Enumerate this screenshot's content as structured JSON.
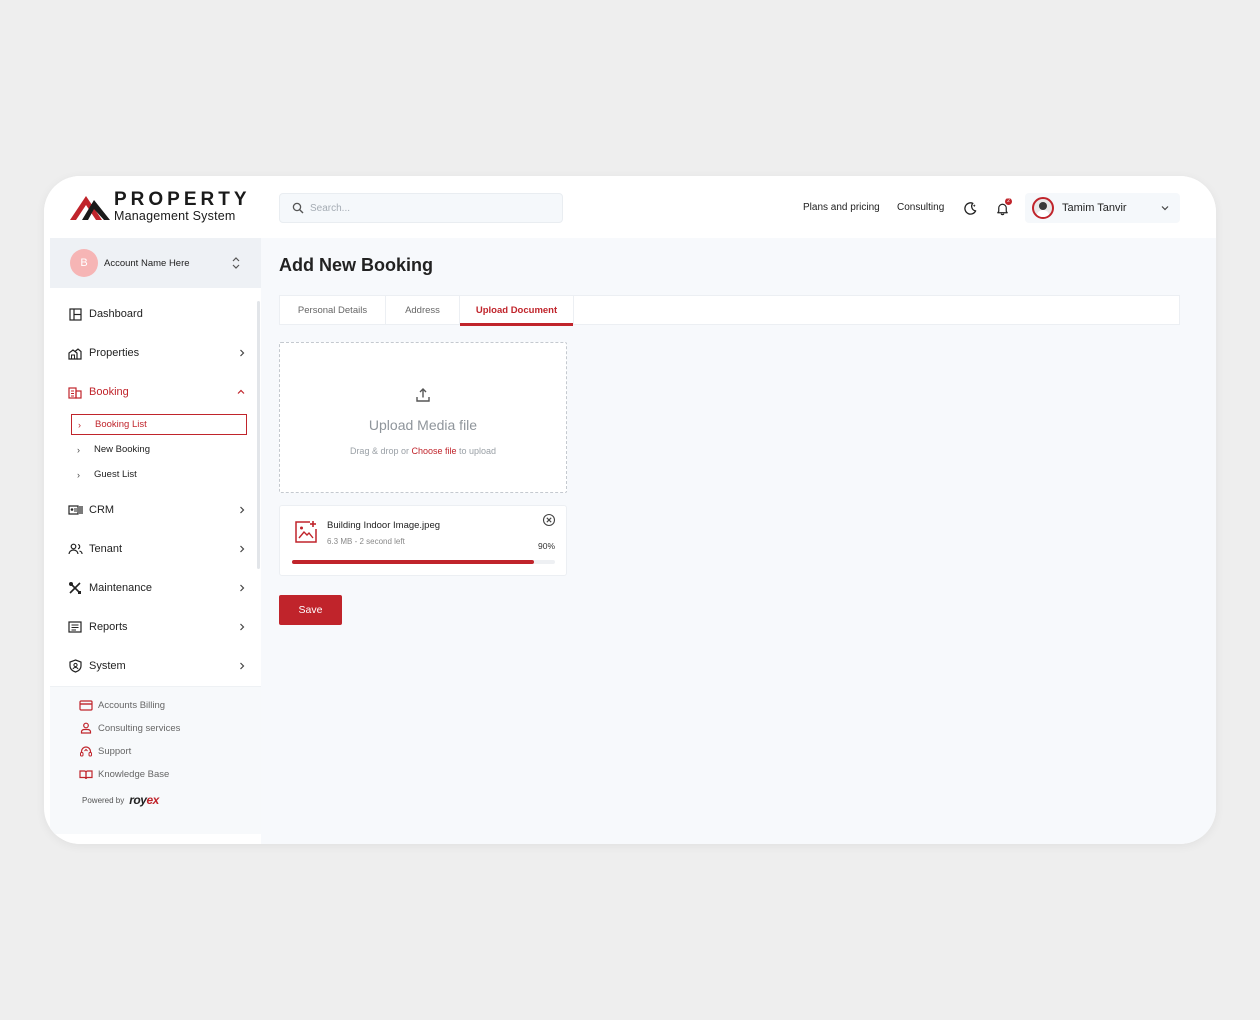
{
  "brand": {
    "title_line1": "PROPERTY",
    "title_line2": "Management System",
    "color": "#c0242b"
  },
  "header": {
    "search_placeholder": "Search...",
    "nav_links": [
      "Plans and pricing",
      "Consulting"
    ],
    "notification_count": "2",
    "user_name": "Tamim Tanvir"
  },
  "sidebar": {
    "account": {
      "initial": "B",
      "name": "Account Name Here"
    },
    "menu": [
      {
        "label": "Dashboard",
        "icon": "dashboard-icon"
      },
      {
        "label": "Properties",
        "icon": "properties-icon"
      },
      {
        "label": "Booking",
        "icon": "booking-icon"
      },
      {
        "label": "CRM",
        "icon": "crm-icon"
      },
      {
        "label": "Tenant",
        "icon": "tenant-icon"
      },
      {
        "label": "Maintenance",
        "icon": "maintenance-icon"
      },
      {
        "label": "Reports",
        "icon": "reports-icon"
      },
      {
        "label": "System",
        "icon": "system-icon"
      }
    ],
    "booking_sub": [
      "Booking List",
      "New Booking",
      "Guest List"
    ],
    "bottom_links": [
      {
        "label": "Accounts Billing",
        "icon": "credit-card-icon"
      },
      {
        "label": "Consulting services",
        "icon": "user-icon"
      },
      {
        "label": "Support",
        "icon": "headset-icon"
      },
      {
        "label": "Knowledge Base",
        "icon": "book-icon"
      }
    ],
    "powered_by": "Powered by",
    "powered_brand_a": "roy",
    "powered_brand_b": "ex"
  },
  "main": {
    "title": "Add New Booking",
    "tabs": [
      "Personal Details",
      "Address",
      "Upload Document"
    ],
    "active_tab": "Upload Document",
    "upload": {
      "title": "Upload Media file",
      "sub_before": "Drag & drop or ",
      "sub_link": "Choose file",
      "sub_after": " to upload"
    },
    "file": {
      "name": "Building Indoor Image.jpeg",
      "meta": "6.3 MB - 2 second left",
      "percent_label": "90%",
      "progress": 0.92
    },
    "save_label": "Save"
  }
}
